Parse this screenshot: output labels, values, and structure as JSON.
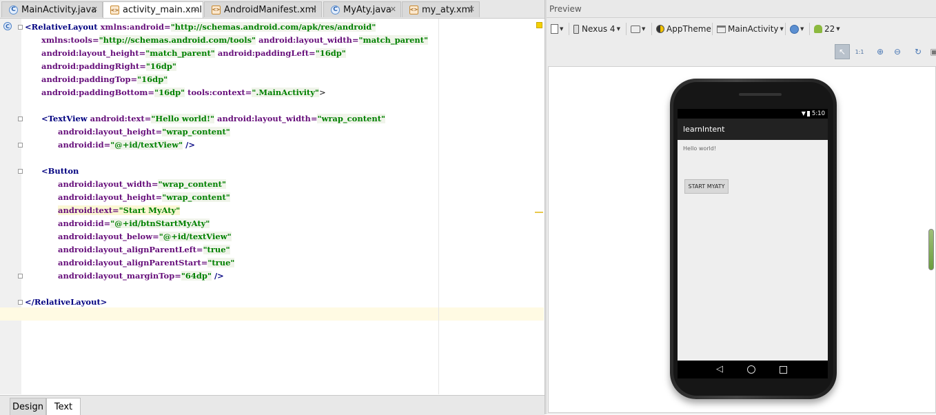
{
  "tabs": [
    {
      "label": "MainActivity.java",
      "type": "java"
    },
    {
      "label": "activity_main.xml",
      "type": "xml",
      "active": true
    },
    {
      "label": "AndroidManifest.xml",
      "type": "xml"
    },
    {
      "label": "MyAty.java",
      "type": "java"
    },
    {
      "label": "my_aty.xml",
      "type": "xml"
    }
  ],
  "code": [
    [
      "<RelativeLayout ",
      "xmlns:android=",
      "\"http://schemas.android.com/apk/res/android\""
    ],
    [
      "xmlns:tools=",
      "\"http://schemas.android.com/tools\"",
      " android:layout_width=",
      "\"match_parent\""
    ],
    [
      "android:layout_height=",
      "\"match_parent\"",
      " android:paddingLeft=",
      "\"16dp\""
    ],
    [
      "android:paddingRight=",
      "\"16dp\""
    ],
    [
      "android:paddingTop=",
      "\"16dp\""
    ],
    [
      "android:paddingBottom=",
      "\"16dp\"",
      " tools:context=",
      "\".MainActivity\"",
      ">"
    ],
    [
      "<TextView ",
      "android:text=",
      "\"Hello world!\"",
      " android:layout_width=",
      "\"wrap_content\""
    ],
    [
      "android:layout_height=",
      "\"wrap_content\""
    ],
    [
      "android:id=",
      "\"@+id/textView\"",
      " />"
    ],
    [
      "<Button"
    ],
    [
      "android:layout_width=",
      "\"wrap_content\""
    ],
    [
      "android:layout_height=",
      "\"wrap_content\""
    ],
    [
      "android:text=",
      "\"Start MyAty\""
    ],
    [
      "android:id=",
      "\"@+id/btnStartMyAty\""
    ],
    [
      "android:layout_below=",
      "\"@+id/textView\""
    ],
    [
      "android:layout_alignParentLeft=",
      "\"true\""
    ],
    [
      "android:layout_alignParentStart=",
      "\"true\""
    ],
    [
      "android:layout_marginTop=",
      "\"64dp\"",
      " />"
    ],
    [
      "</RelativeLayout>"
    ]
  ],
  "bottom_tabs": {
    "design": "Design",
    "text": "Text"
  },
  "preview": {
    "title": "Preview",
    "device": "Nexus 4",
    "theme": "AppTheme",
    "activity": "MainActivity",
    "api": "22",
    "phone": {
      "time": "5:10",
      "app_title": "learnIntent",
      "hello_text": "Hello world!",
      "button_label": "START MYATY"
    }
  }
}
